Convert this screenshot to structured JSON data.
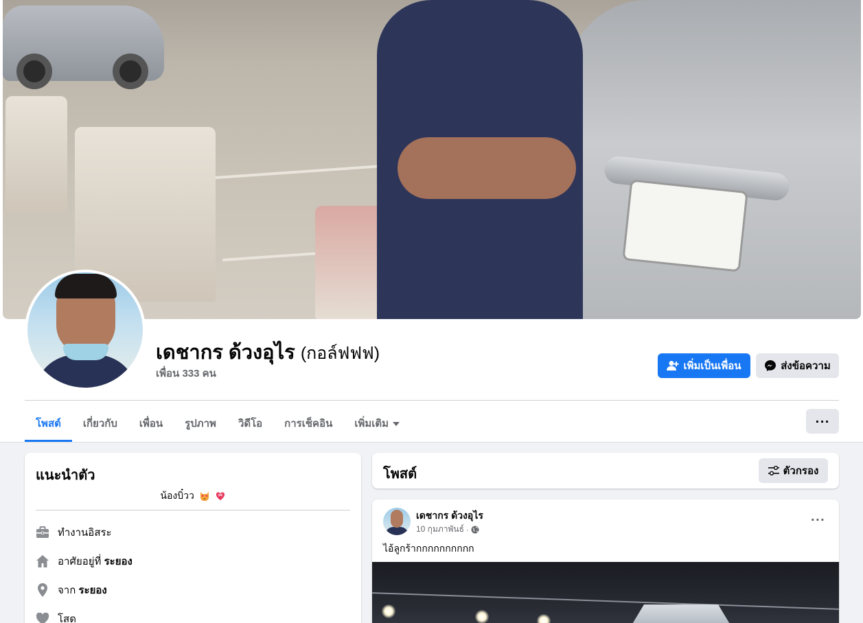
{
  "profile": {
    "name": "เดชากร ด้วงอุไร",
    "alternate_name": "(กอล์ฟฟฟ)",
    "friends": "เพื่อน 333 คน"
  },
  "actions": {
    "add_friend": "เพิ่มเป็นเพื่อน",
    "message": "ส่งข้อความ",
    "more": "···"
  },
  "tabs": [
    {
      "label": "โพสต์",
      "active": true
    },
    {
      "label": "เกี่ยวกับ",
      "active": false
    },
    {
      "label": "เพื่อน",
      "active": false
    },
    {
      "label": "รูปภาพ",
      "active": false
    },
    {
      "label": "วิดีโอ",
      "active": false
    },
    {
      "label": "การเช็คอิน",
      "active": false
    },
    {
      "label": "เพิ่มเติม",
      "active": false
    }
  ],
  "intro": {
    "title": "แนะนำตัว",
    "bio": "น้องบิ๋วว",
    "bio_emojis": [
      "heart-eyes-cat",
      "heart-ribbon"
    ],
    "items": [
      {
        "icon": "briefcase-icon",
        "text": "ทำงานอิสระ",
        "bold": ""
      },
      {
        "icon": "home-icon",
        "text": "อาศัยอยู่ที่ ",
        "bold": "ระยอง"
      },
      {
        "icon": "location-pin-icon",
        "text": "จาก ",
        "bold": "ระยอง"
      },
      {
        "icon": "heart-icon",
        "text": "โสด",
        "bold": ""
      }
    ]
  },
  "posts_section": {
    "title": "โพสต์",
    "filter_label": "ตัวกรอง"
  },
  "post": {
    "author": "เดชากร ด้วงอุไร",
    "date": "10 กุมภาพันธ์",
    "separator": "·",
    "text": "ไอ้ลูกร้ากกกกกกกกกก",
    "options": "···"
  },
  "colors": {
    "primary": "#1877f2",
    "secondary_button": "#e4e6eb",
    "page_background": "#f0f2f5",
    "muted_text": "#65676b"
  }
}
